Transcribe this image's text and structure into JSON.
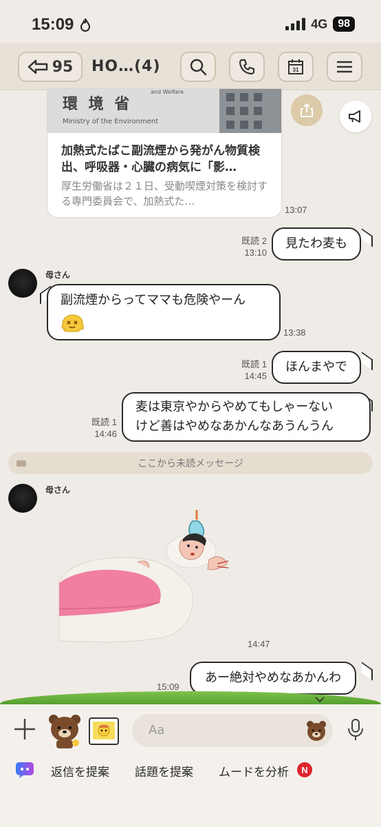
{
  "status": {
    "time": "15:09",
    "network": "4G",
    "battery": "98"
  },
  "header": {
    "back_count": "95",
    "title": "HO…(4)"
  },
  "article": {
    "image_kanji": "環 境 省",
    "image_en": "Ministry of the Environment",
    "image_top": "and Welfare",
    "title": "加熱式たばこ副流煙から発がん物質検出、呼吸器・心臓の病気に「影…",
    "desc": "厚生労働省は２１日、受動喫煙対策を検討する専門委員会で、加熱式た…",
    "time": "13:07"
  },
  "messages": {
    "m1": {
      "text": "見たわ麦も",
      "read": "既読 2",
      "time": "13:10"
    },
    "m2": {
      "sender": "母さん",
      "text": "副流煙からってママも危険やーん",
      "time": "13:38"
    },
    "m3": {
      "text": "ほんまやで",
      "read": "既読 1",
      "time": "14:45"
    },
    "m4": {
      "line1": "麦は東京やからやめてもしゃーない",
      "line2": "けど善はやめなあかんなあうんうん",
      "read": "既読 1",
      "time": "14:46"
    },
    "unread_divider": "ここから未読メッセージ",
    "m5": {
      "sender": "母さん",
      "time": "14:47"
    },
    "m6": {
      "text": "あー絶対やめなあかんわ",
      "time": "15:09"
    }
  },
  "input": {
    "placeholder": "Aa"
  },
  "ai": {
    "suggest_reply": "返信を提案",
    "suggest_topic": "話題を提案",
    "analyze_mood": "ムードを分析",
    "badge": "N"
  },
  "colors": {
    "background": "#efebe6",
    "header": "#e8e1d8",
    "badge": "#e0242e"
  }
}
